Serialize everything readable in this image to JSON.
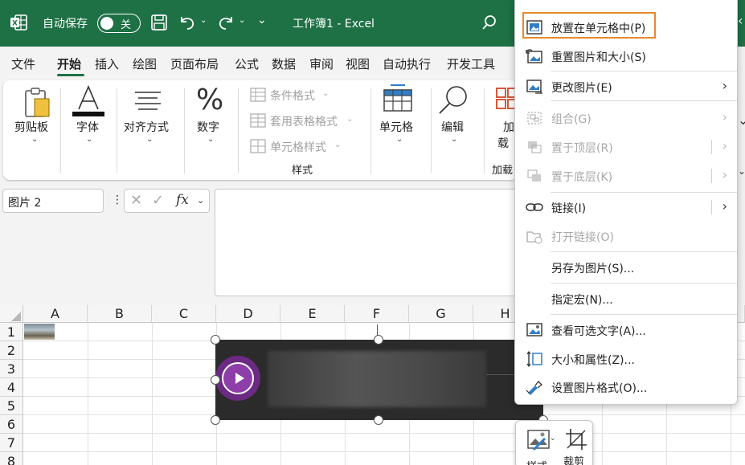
{
  "titlebar": {
    "autosave_label": "自动保存",
    "autosave_state": "关",
    "doc_title": "工作簿1  -  Excel"
  },
  "tabs": [
    "文件",
    "开始",
    "插入",
    "绘图",
    "页面布局",
    "公式",
    "数据",
    "审阅",
    "视图",
    "自动执行",
    "开发工具"
  ],
  "ribbon": {
    "paste": "剪贴板",
    "font": "字体",
    "align": "对齐方式",
    "number": "数字",
    "cond_format": "条件格式",
    "table_format": "套用表格格式",
    "cell_style": "单元格样式",
    "styles_group": "样式",
    "cells": "单元格",
    "edit": "编辑",
    "addin_partial": "加",
    "addin_partial2": "载",
    "addin_group_partial": "加载"
  },
  "formula": {
    "name_box": "图片 2",
    "fx": "fx"
  },
  "grid": {
    "columns": [
      "A",
      "B",
      "C",
      "D",
      "E",
      "F",
      "G",
      "H"
    ],
    "rows": [
      "1",
      "2",
      "3",
      "4",
      "5",
      "6",
      "7",
      "8"
    ]
  },
  "minibar": {
    "style": "样式",
    "crop": "裁剪"
  },
  "context_menu": {
    "items": [
      {
        "label": "放置在单元格中(P)",
        "icon": "place-in-cell-icon",
        "enabled": true
      },
      {
        "label": "重置图片和大小(S)",
        "icon": "reset-picture-icon",
        "enabled": true
      },
      {
        "label": "更改图片(E)",
        "icon": "change-picture-icon",
        "enabled": true,
        "submenu": true
      },
      {
        "label": "组合(G)",
        "icon": "group-icon",
        "enabled": false,
        "submenu": true
      },
      {
        "label": "置于顶层(R)",
        "icon": "bring-front-icon",
        "enabled": false,
        "submenu": true
      },
      {
        "label": "置于底层(K)",
        "icon": "send-back-icon",
        "enabled": false,
        "submenu": true
      },
      {
        "label": "链接(I)",
        "icon": "link-icon",
        "enabled": true,
        "submenu": true
      },
      {
        "label": "打开链接(O)",
        "icon": "open-link-icon",
        "enabled": false
      },
      {
        "label": "另存为图片(S)...",
        "icon": "",
        "enabled": true
      },
      {
        "label": "指定宏(N)...",
        "icon": "",
        "enabled": true
      },
      {
        "label": "查看可选文字(A)...",
        "icon": "alt-text-icon",
        "enabled": true
      },
      {
        "label": "大小和属性(Z)...",
        "icon": "size-properties-icon",
        "enabled": true
      },
      {
        "label": "设置图片格式(O)...",
        "icon": "format-picture-icon",
        "enabled": true
      }
    ]
  },
  "colors": {
    "excel_green": "#1e7145",
    "highlight_orange": "#e8892a",
    "play_purple": "#8e3ea8"
  }
}
